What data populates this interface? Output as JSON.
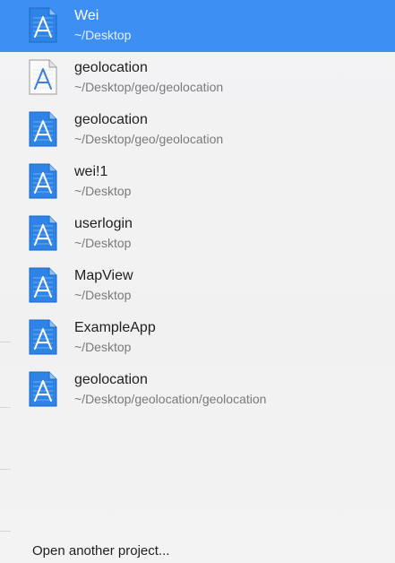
{
  "recent_projects": [
    {
      "name": "Wei",
      "path": "~/Desktop",
      "selected": true,
      "icon": "xcode-project-icon"
    },
    {
      "name": "geolocation",
      "path": "~/Desktop/geo/geolocation",
      "selected": false,
      "icon": "xcode-workspace-icon"
    },
    {
      "name": "geolocation",
      "path": "~/Desktop/geo/geolocation",
      "selected": false,
      "icon": "xcode-project-icon"
    },
    {
      "name": "wei!1",
      "path": "~/Desktop",
      "selected": false,
      "icon": "xcode-project-icon"
    },
    {
      "name": "userlogin",
      "path": "~/Desktop",
      "selected": false,
      "icon": "xcode-project-icon"
    },
    {
      "name": "MapView",
      "path": "~/Desktop",
      "selected": false,
      "icon": "xcode-project-icon"
    },
    {
      "name": "ExampleApp",
      "path": "~/Desktop",
      "selected": false,
      "icon": "xcode-project-icon"
    },
    {
      "name": "geolocation",
      "path": "~/Desktop/geolocation/geolocation",
      "selected": false,
      "icon": "xcode-project-icon"
    }
  ],
  "footer": {
    "open_another_label": "Open another project..."
  },
  "colors": {
    "selection": "#3e8ff4",
    "icon_blue": "#2a7fe0",
    "path_text": "#7a7a7a"
  }
}
